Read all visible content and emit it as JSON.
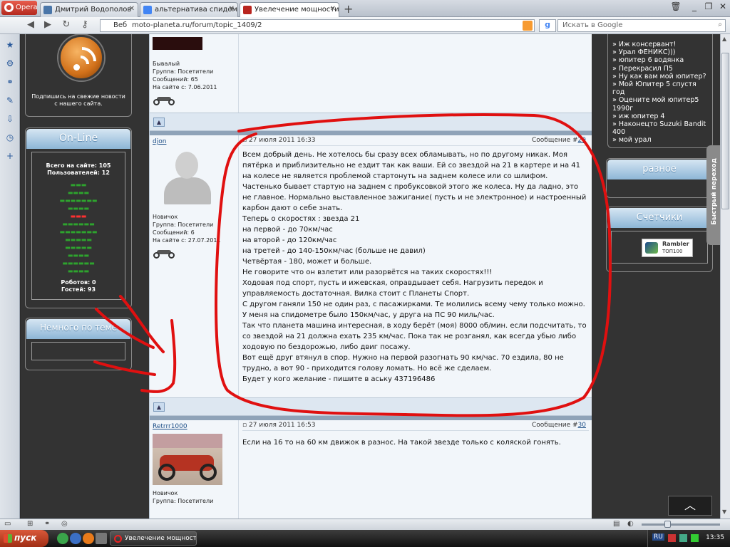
{
  "browser": {
    "menu_label": "Opera",
    "tabs": [
      {
        "title": "Дмитрий Водополов",
        "favicon_color": "#4a76a8"
      },
      {
        "title": "альтернатива спидомет...",
        "favicon_color": "#4285f4"
      },
      {
        "title": "Увелечение мощности ...",
        "favicon_color": "#b8241e"
      }
    ],
    "web_label": "Веб",
    "url": "moto-planeta.ru/forum/topic_1409/2",
    "search_placeholder": "Искать в Google"
  },
  "left_column": {
    "subscribe_text": "Подпишись на свежие новости с нашего сайта.",
    "online": {
      "title": "On-Line",
      "total_on_site": "Всего на сайте: 105",
      "users": "Пользователей: 12",
      "robots": "Роботов: 0",
      "guests": "Гостей: 93"
    },
    "related": {
      "title": "Немного по теме"
    }
  },
  "forum": {
    "post1_user": {
      "rank": "Бывалый",
      "group": "Группа: Посетители",
      "messages": "Сообщений: 65",
      "since": "На сайте с: 7.06.2011"
    },
    "post2": {
      "author": "djon",
      "date": "27 июля 2011 16:33",
      "msg_label": "Сообщение #",
      "msg_num": "29",
      "rank": "Новичок",
      "group": "Группа: Посетители",
      "messages": "Сообщений: 6",
      "since": "На сайте с: 27.07.2011",
      "text": "Всем добрый день. Не хотелось бы сразу всех обламывать, но по другому никак. Моя пятёрка и приблизительно не ездит так как ваши. Ей со звездой на 21 в картере и на 41 на колесе не является проблемой стартонуть на заднем колесе или со шлифом. Частенько бывает стартую на заднем с пробуксовкой этого же колеса. Ну да ладно, это не главное. Нормально выставленное зажигание( пусть и не электронное) и настроенный карбон дают о себе знать.\nТеперь о скоростях : звезда 21\nна первой - до 70км/час\nна второй - до 120км/час\nна третей - до 140-150км/час (больше не давил)\nЧетвёртая - 180, может и больше.\nНе говорите что он взлетит или разорвётся на таких скоростях!!!\nХодовая под спорт, пусть и ижевская, оправдывает себя. Нагрузить передок и управляемость достаточная. Вилка стоит с Планеты Спорт.\nС другом ганяли 150 не один раз, с пасажирками. Те молились всему чему только можно. У меня на спидометре было 150км/час, у друга на ПС 90 миль/час.\nТак что планета машина интересная, в ходу берёт (моя) 8000 об/мин. если подсчитать, то со звездой на 21 должна ехать 235 км/час. Пока так не розганял, как всегда убью либо ходовую по бездорожью, либо двиг посажу.\nВот ещё друг втянул в спор. Нужно на первой разогнать 90 км/час. 70 ездила, 80 не трудно, а вот 90 - приходится голову ломать. Но всё же сделаем.\nБудет у кого желание - пишите в аську 437196486"
    },
    "post3": {
      "author": "Retrrr1000",
      "date": "27 июля 2011 16:53",
      "msg_label": "Сообщение #",
      "msg_num": "30",
      "rank": "Новичок",
      "group": "Группа: Посетители",
      "text": "Если на 16 то на 60 км движок в разнос. На такой звезде только с коляской гонять."
    }
  },
  "right_column": {
    "links": [
      "» Иж консервант!",
      "» Урал ФЕНИКС)))",
      "» юпитер 6 водянка",
      "» Перекрасил П5",
      "» Ну как вам мой юпитер?",
      "» Мой Юпитер 5 спустя год",
      "» Оцените мой юпитер5 1990г",
      "» иж юпитер 4",
      "» Наконецто Suzuki Bandit 400",
      "» мой урал"
    ],
    "misc_title": "разное",
    "counters_title": "Счетчики",
    "rambler_brand": "Rambler",
    "rambler_sub": "ТОП100",
    "quick_nav": "Быстрый переход"
  },
  "taskbar": {
    "start_label": "пуск",
    "task_title": "Увелечение мощност...",
    "lang": "RU",
    "clock": "13:35"
  },
  "colors": {
    "accent": "#8db6d6",
    "annotation": "#e01010",
    "online_name": "#2ea32e"
  }
}
